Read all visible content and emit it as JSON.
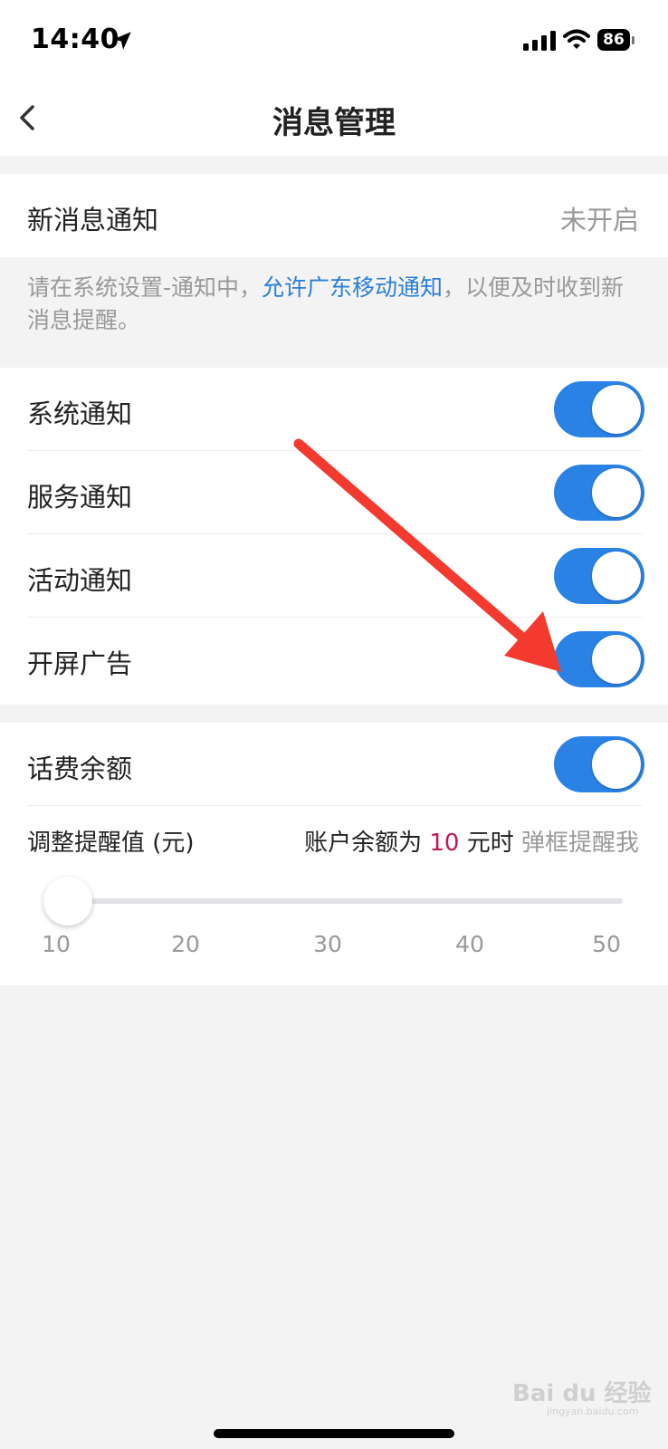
{
  "status_bar": {
    "time": "14:40",
    "battery": "86"
  },
  "header": {
    "title": "消息管理"
  },
  "new_message": {
    "label": "新消息通知",
    "status": "未开启"
  },
  "hint": {
    "prefix": "请在系统设置-通知中，",
    "link": "允许广东移动通知",
    "suffix": "，以便及时收到新消息提醒。"
  },
  "toggles": [
    {
      "label": "系统通知",
      "on": true
    },
    {
      "label": "服务通知",
      "on": true
    },
    {
      "label": "活动通知",
      "on": true
    },
    {
      "label": "开屏广告",
      "on": true
    }
  ],
  "balance": {
    "label": "话费余额",
    "on": true,
    "adjust_label": "调整提醒值 (元)",
    "reminder_prefix": "账户余额为",
    "amount": "10",
    "reminder_mid": "元时",
    "reminder_tail": "弹框提醒我",
    "slider_value": 10,
    "slider_min": 10,
    "slider_max": 50,
    "ticks": [
      "10",
      "20",
      "30",
      "40",
      "50"
    ]
  },
  "watermark": {
    "brand": "Bai du 经验",
    "site": "jingyan.baidu.com"
  },
  "colors": {
    "accent": "#2a82e4",
    "link": "#2a7fd8",
    "amount": "#c2185b",
    "arrow": "#f4392f"
  }
}
